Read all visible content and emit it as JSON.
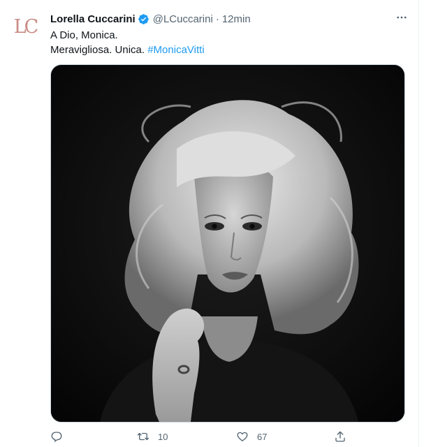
{
  "tweet": {
    "avatar_initials": "LC",
    "author_name": "Lorella Cuccarini",
    "handle": "@LCuccarini",
    "separator": "·",
    "timestamp": "12min",
    "line1": "A Dio, Monica.",
    "line2_text": "Meravigliosa. Unica. ",
    "hashtag": "#MonicaVitti",
    "media": {
      "alt": "Black and white portrait photo of a woman with voluminous blonde hair",
      "style": "black-and-white"
    },
    "actions": {
      "reply_count": "",
      "retweet_count": "10",
      "like_count": "67",
      "share_count": ""
    },
    "icons": [
      "verified-badge-icon",
      "more-icon",
      "reply-icon",
      "retweet-icon",
      "like-icon",
      "share-icon"
    ],
    "colors": {
      "accent": "#1d9bf0",
      "secondary_text": "#536471",
      "avatar_logo": "#c98b84"
    }
  }
}
